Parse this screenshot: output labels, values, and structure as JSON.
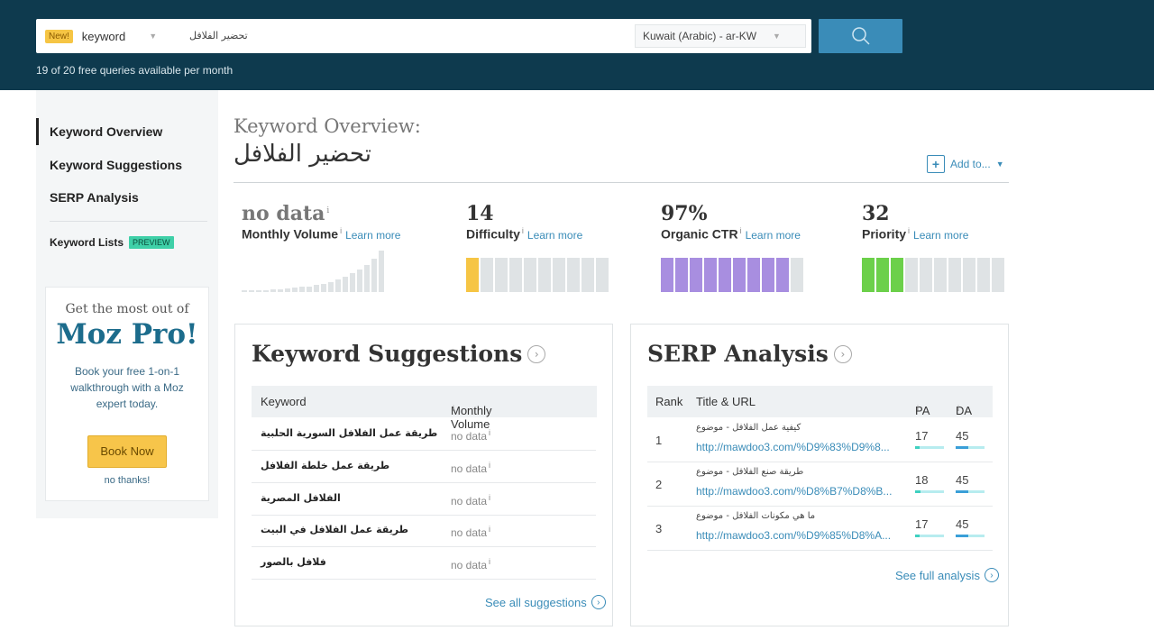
{
  "topbar": {
    "new_badge": "New!",
    "type_value": "keyword",
    "query_value": "تحضير الفلافل",
    "locale_value": "Kuwait (Arabic) - ar-KW",
    "search_icon": "search-icon",
    "queries_note": "19 of 20 free queries available per month"
  },
  "sidebar": {
    "items": [
      {
        "label": "Keyword Overview",
        "active": true
      },
      {
        "label": "Keyword Suggestions",
        "active": false
      },
      {
        "label": "SERP Analysis",
        "active": false
      }
    ],
    "keyword_lists": "Keyword Lists",
    "preview_badge": "PREVIEW",
    "promo": {
      "top": "Get the most out of",
      "title": "Moz Pro!",
      "body": "Book your free 1-on-1 walkthrough with a Moz expert today.",
      "button": "Book Now",
      "no_thanks": "no thanks!"
    }
  },
  "header": {
    "title": "Keyword Overview:",
    "query": "تحضير الفلافل",
    "add_to": "Add to...",
    "add_icon": "plus-icon",
    "add_caret": "▼"
  },
  "metrics": {
    "info": "i",
    "learn_more": "Learn more",
    "volume": {
      "value": "no data",
      "label": "Monthly Volume",
      "bar_levels": [
        0.05,
        0.05,
        0.05,
        0.05,
        0.07,
        0.07,
        0.09,
        0.1,
        0.12,
        0.14,
        0.17,
        0.2,
        0.24,
        0.3,
        0.37,
        0.45,
        0.55,
        0.65,
        0.8,
        1.0
      ]
    },
    "difficulty": {
      "value": "14",
      "label": "Difficulty",
      "filled": 1,
      "segments": 10,
      "color": "#f6c544"
    },
    "ctr": {
      "value": "97%",
      "label": "Organic CTR",
      "filled": 9,
      "segments": 10,
      "color": "#a88ee0"
    },
    "priority": {
      "value": "32",
      "label": "Priority",
      "filled": 3,
      "segments": 10,
      "color": "#6cd04a"
    }
  },
  "suggestions": {
    "title": "Keyword Suggestions",
    "col_keyword": "Keyword",
    "col_volume": "Monthly Volume",
    "rows": [
      {
        "keyword": "طريقة عمل الفلافل السورية الحلبية",
        "volume": "no data"
      },
      {
        "keyword": "طريقة عمل خلطة الفلافل",
        "volume": "no data"
      },
      {
        "keyword": "الفلافل المصرية",
        "volume": "no data"
      },
      {
        "keyword": "طريقة عمل الفلافل في البيت",
        "volume": "no data"
      },
      {
        "keyword": "فلافل بالصور",
        "volume": "no data"
      }
    ],
    "see_all": "See all suggestions",
    "arrow": "›"
  },
  "serp": {
    "title": "SERP Analysis",
    "col_rank": "Rank",
    "col_title": "Title & URL",
    "col_pa": "PA",
    "col_da": "DA",
    "rows": [
      {
        "rank": "1",
        "title": "كيفية عمل الفلافل - موضوع",
        "url": "http://mawdoo3.com/%D9%83%D9%8...",
        "pa": "17",
        "da": "45",
        "pa_level": 0.17,
        "da_level": 0.45
      },
      {
        "rank": "2",
        "title": "طريقة صنع الفلافل - موضوع",
        "url": "http://mawdoo3.com/%D8%B7%D8%B...",
        "pa": "18",
        "da": "45",
        "pa_level": 0.18,
        "da_level": 0.45
      },
      {
        "rank": "3",
        "title": "ما هي مكونات الفلافل - موضوع",
        "url": "http://mawdoo3.com/%D9%85%D8%A...",
        "pa": "17",
        "da": "45",
        "pa_level": 0.17,
        "da_level": 0.45
      }
    ],
    "see_full": "See full analysis",
    "arrow": "›"
  },
  "colors": {
    "topbar": "#0e3a4e",
    "accent": "#3a8cb8",
    "pa_bar": "#3fd0c0",
    "da_bar": "#3a9fd8"
  }
}
